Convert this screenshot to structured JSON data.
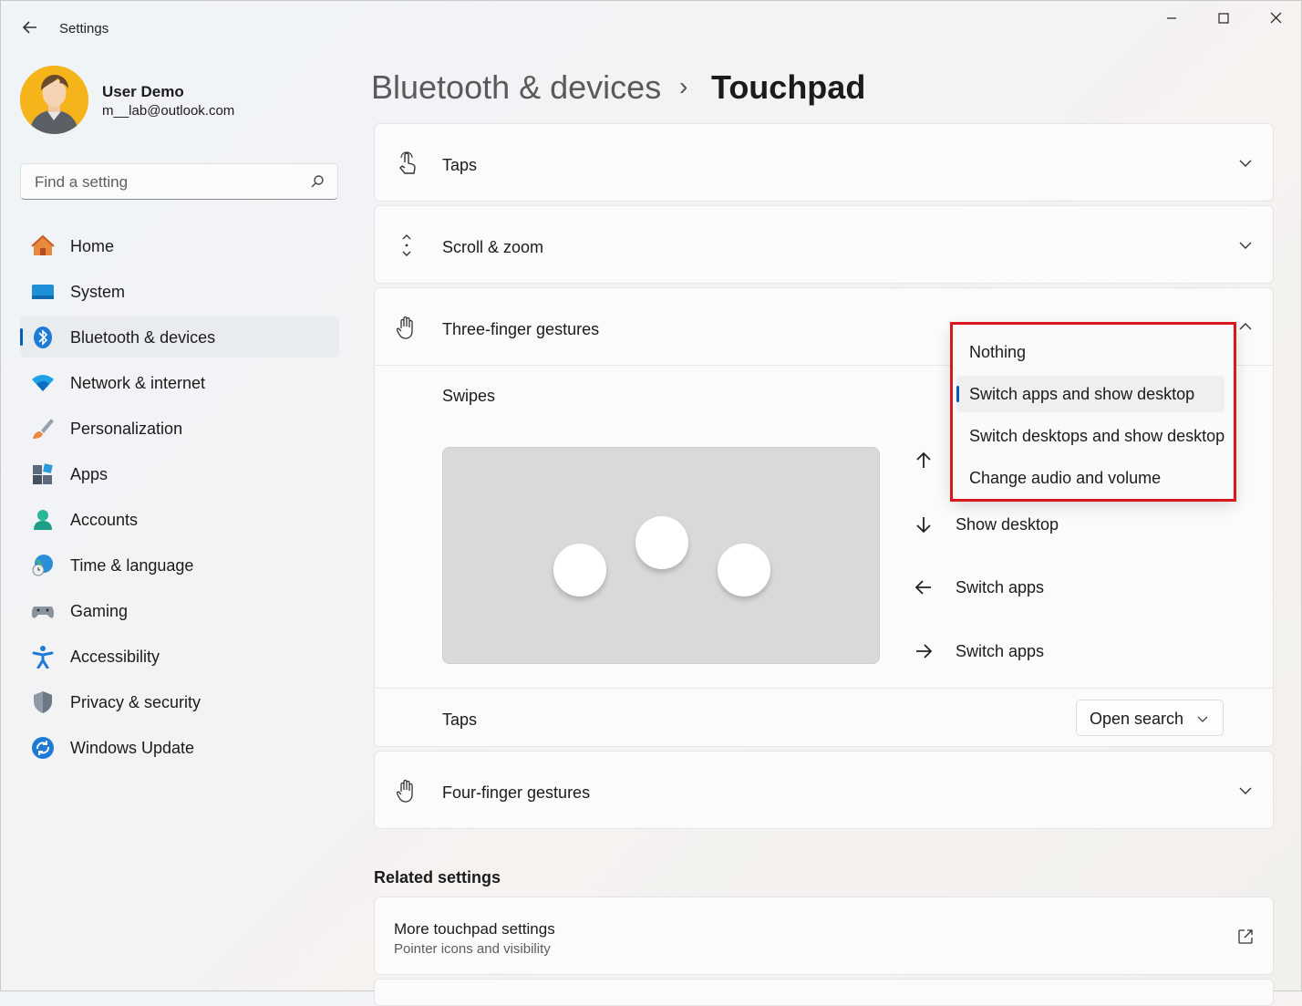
{
  "window": {
    "title": "Settings",
    "minimize": "–",
    "maximize": "☐",
    "close": "✕"
  },
  "user": {
    "name": "User Demo",
    "email": "m__lab@outlook.com"
  },
  "search": {
    "placeholder": "Find a setting"
  },
  "nav": {
    "items": [
      {
        "label": "Home",
        "icon": "home-icon"
      },
      {
        "label": "System",
        "icon": "system-icon"
      },
      {
        "label": "Bluetooth & devices",
        "icon": "bluetooth-icon",
        "active": true
      },
      {
        "label": "Network & internet",
        "icon": "wifi-icon"
      },
      {
        "label": "Personalization",
        "icon": "brush-icon"
      },
      {
        "label": "Apps",
        "icon": "apps-icon"
      },
      {
        "label": "Accounts",
        "icon": "accounts-icon"
      },
      {
        "label": "Time & language",
        "icon": "globe-clock-icon"
      },
      {
        "label": "Gaming",
        "icon": "gamepad-icon"
      },
      {
        "label": "Accessibility",
        "icon": "accessibility-icon"
      },
      {
        "label": "Privacy & security",
        "icon": "shield-icon"
      },
      {
        "label": "Windows Update",
        "icon": "update-icon"
      }
    ]
  },
  "breadcrumb": {
    "parent": "Bluetooth & devices",
    "separator": "›",
    "current": "Touchpad"
  },
  "sections": {
    "taps": "Taps",
    "scroll_zoom": "Scroll & zoom",
    "three_finger": {
      "label": "Three-finger gestures",
      "swipes_label": "Swipes",
      "swipes": [
        {
          "direction": "up",
          "action": ""
        },
        {
          "direction": "down",
          "action": "Show desktop"
        },
        {
          "direction": "left",
          "action": "Switch apps"
        },
        {
          "direction": "right",
          "action": "Switch apps"
        }
      ],
      "taps_label": "Taps",
      "taps_value": "Open search"
    },
    "four_finger": "Four-finger gestures"
  },
  "related": {
    "title": "Related settings",
    "more_touchpad": {
      "title": "More touchpad settings",
      "subtitle": "Pointer icons and visibility"
    }
  },
  "dropdown": {
    "options": [
      "Nothing",
      "Switch apps and show desktop",
      "Switch desktops and show desktop",
      "Change audio and volume"
    ],
    "selected": "Switch apps and show desktop"
  },
  "colors": {
    "accent": "#005fb8",
    "highlight": "#d7181f"
  }
}
